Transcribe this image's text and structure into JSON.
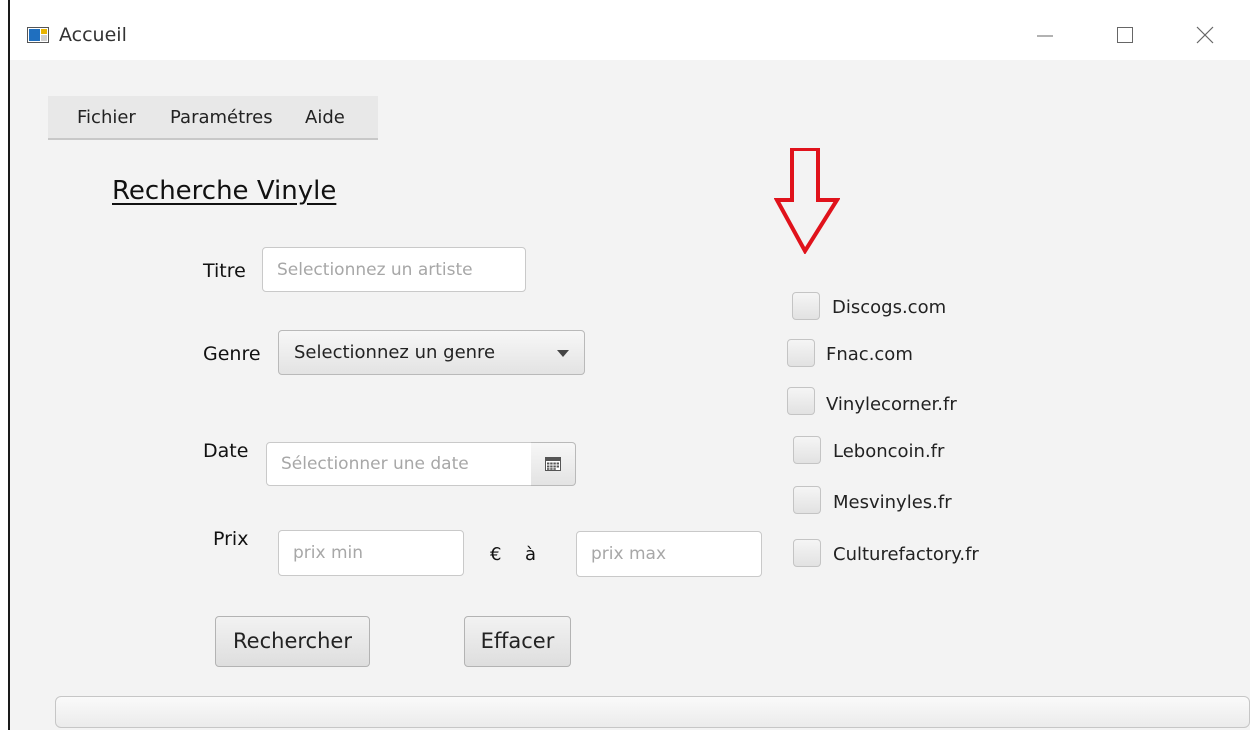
{
  "window": {
    "title": "Accueil"
  },
  "menu": {
    "items": [
      "Fichier",
      "Paramétres",
      "Aide"
    ]
  },
  "heading": "Recherche Vinyle",
  "form": {
    "titre_label": "Titre",
    "titre_placeholder": "Selectionnez un artiste",
    "genre_label": "Genre",
    "genre_value": "Selectionnez un genre",
    "date_label": "Date",
    "date_placeholder": "Sélectionner une date",
    "prix_label": "Prix",
    "prix_min_placeholder": "prix min",
    "currency": "€",
    "range_sep": "à",
    "prix_max_placeholder": "prix max",
    "search_button": "Rechercher",
    "clear_button": "Effacer"
  },
  "sites": [
    "Discogs.com",
    "Fnac.com",
    "Vinylecorner.fr",
    "Leboncoin.fr",
    "Mesvinyles.fr",
    "Culturefactory.fr"
  ],
  "colors": {
    "arrow": "#e0121b"
  },
  "icons": {
    "app": "window-icon",
    "date": "calendar-icon",
    "genre": "chevron-down-icon"
  }
}
